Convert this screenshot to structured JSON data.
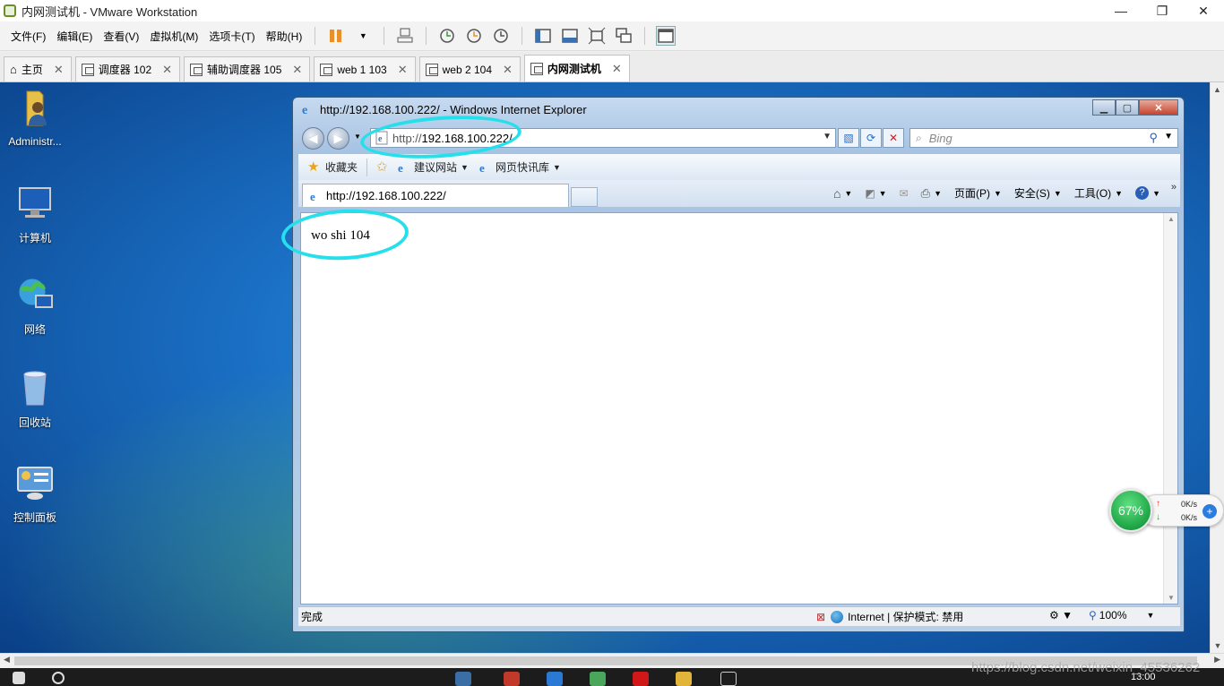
{
  "vmware": {
    "title": "内网测试机 - VMware Workstation",
    "window_controls": [
      "—",
      "❐",
      "✕"
    ],
    "menu": [
      "文件(F)",
      "编辑(E)",
      "查看(V)",
      "虚拟机(M)",
      "选项卡(T)",
      "帮助(H)"
    ],
    "tabs": [
      {
        "label": "主页",
        "icon": "home-icon",
        "active": false
      },
      {
        "label": "调度器 102",
        "icon": "vm-icon",
        "active": false
      },
      {
        "label": "辅助调度器 105",
        "icon": "vm-icon",
        "active": false
      },
      {
        "label": "web 1 103",
        "icon": "vm-play-icon",
        "active": false
      },
      {
        "label": "web 2 104",
        "icon": "vm-play-icon",
        "active": false
      },
      {
        "label": "内网测试机",
        "icon": "vm-play-icon",
        "active": true
      }
    ],
    "tab_close": "✕"
  },
  "desktop": {
    "icons": [
      {
        "label": "Administr...",
        "icon": "user-folder-icon"
      },
      {
        "label": "计算机",
        "icon": "computer-icon"
      },
      {
        "label": "网络",
        "icon": "network-icon"
      },
      {
        "label": "回收站",
        "icon": "recycle-bin-icon"
      },
      {
        "label": "控制面板",
        "icon": "control-panel-icon"
      }
    ]
  },
  "ie": {
    "title": "http://192.168.100.222/ - Windows Internet Explorer",
    "address_prefix": "http://",
    "address_host": "192.168.100.222/",
    "search_placeholder": "Bing",
    "favorites_label": "收藏夹",
    "suggested_sites": "建议网站",
    "web_slice_gallery": "网页快讯库",
    "tab_title": "http://192.168.100.222/",
    "cmd": {
      "page": "页面(P)",
      "safety": "安全(S)",
      "tools": "工具(O)"
    },
    "page_text": "wo shi 104",
    "status": {
      "done": "完成",
      "zone": "Internet | 保护模式: 禁用",
      "zoom": "100%"
    }
  },
  "net_widget": {
    "percent": "67%",
    "up": "0K/s",
    "down": "0K/s"
  },
  "taskbar": {
    "clock": "13:00"
  },
  "watermark": "https://blog.csdn.net/weixin_45536262",
  "colors": {
    "annotation": "#25e0ea",
    "desktop_blue": "#1a6fc4"
  }
}
